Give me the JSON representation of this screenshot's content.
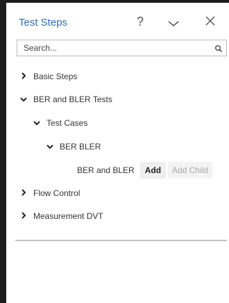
{
  "panel": {
    "title": "Test Steps",
    "help_label": "?",
    "collapse_icon": "chevron-down-icon",
    "close_icon": "close-icon"
  },
  "search": {
    "placeholder": "Search...",
    "value": "",
    "icon": "search-icon"
  },
  "tree": {
    "basic_steps": "Basic Steps",
    "ber_bler_tests": "BER and BLER Tests",
    "test_cases": "Test Cases",
    "ber_bler": "BER BLER",
    "leaf": {
      "label": "BER and BLER",
      "add_label": "Add",
      "add_child_label": "Add Child"
    },
    "flow_control": "Flow Control",
    "measurement_dvt": "Measurement DVT"
  },
  "colors": {
    "title": "#2f6fb5",
    "text": "#333333",
    "disabled_text": "#a8a8a8"
  }
}
